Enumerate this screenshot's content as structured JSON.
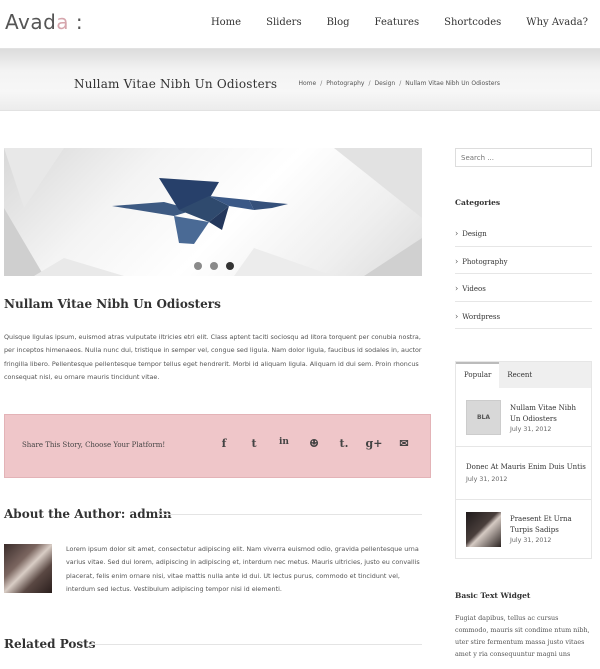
{
  "brand": {
    "name_main": "Avad",
    "name_accent": "a",
    "suffix": " :"
  },
  "nav": [
    "Home",
    "Sliders",
    "Blog",
    "Features",
    "Shortcodes",
    "Why Avada?"
  ],
  "titlebar": {
    "title": "Nullam Vitae Nibh Un Odiosters",
    "breadcrumb": [
      "Home",
      "Photography",
      "Design",
      "Nullam Vitae Nibh Un Odiosters"
    ],
    "breadcrumb_sep": "/"
  },
  "slider": {
    "dots": 3,
    "active_dot": 2
  },
  "post": {
    "title": "Nullam Vitae Nibh Un Odiosters",
    "excerpt": "Quisque ligulas ipsum, euismod atras vulputate iltricies etri elit. Class aptent taciti sociosqu ad litora torquent per conubia nostra, per inceptos himenaeos. Nulla nunc dui, tristique in semper vel, congue sed ligula. Nam dolor ligula, faucibus id sodales in, auctor fringilla libero. Pellentesque pellentesque tempor tellus eget hendrerit. Morbi id aliquam ligula. Aliquam id dui sem. Proin rhoncus consequat nisl, eu ornare mauris tincidunt vitae."
  },
  "share": {
    "label": "Share This Story, Choose Your Platform!",
    "icons": [
      {
        "name": "facebook-icon",
        "glyph": "f"
      },
      {
        "name": "twitter-icon",
        "glyph": "t"
      },
      {
        "name": "linkedin-icon",
        "glyph": "in"
      },
      {
        "name": "reddit-icon",
        "glyph": "☻"
      },
      {
        "name": "tumblr-icon",
        "glyph": "t."
      },
      {
        "name": "google-plus-icon",
        "glyph": "g+"
      },
      {
        "name": "email-icon",
        "glyph": "✉"
      }
    ]
  },
  "author": {
    "heading": "About the Author: admin",
    "bio": "Lorem ipsum dolor sit amet, consectetur adipiscing elit. Nam viverra euismod odio, gravida pellentesque urna varius vitae. Sed dui lorem, adipiscing in adipiscing et, interdum nec metus. Mauris ultricies, justo eu convallis placerat, felis enim ornare nisi, vitae mattis nulla ante id dui. Ut lectus purus, commodo et tincidunt vel, interdum sed lectus. Vestibulum adipiscing tempor nisi id elementi."
  },
  "related": {
    "heading": "Related Posts"
  },
  "sidebar": {
    "search_placeholder": "Search ...",
    "categories_heading": "Categories",
    "categories": [
      "Design",
      "Photography",
      "Videos",
      "Wordpress"
    ],
    "tabs": [
      "Popular",
      "Recent"
    ],
    "tab_posts": [
      {
        "title": "Nullam Vitae Nibh Un Odiosters",
        "date": "July 31, 2012",
        "thumb_text": "BLA"
      },
      {
        "title": "Donec At Mauris Enim Duis Untis",
        "date": "July 31, 2012"
      },
      {
        "title": "Praesent Et Urna Turpis Sadips",
        "date": "July 31, 2012"
      }
    ],
    "widget_heading": "Basic Text Widget",
    "widget_text": "Fugiat dapibus, tellus ac cursus commodo, mauris sit condime ntum nibh, uter stire fermentum massa justo vitaes amet y ria consequuntur magni uns"
  },
  "colors": {
    "accent": "#d6a6ad",
    "share_bg": "#efc6c9",
    "bird": "#2f4a6e"
  }
}
